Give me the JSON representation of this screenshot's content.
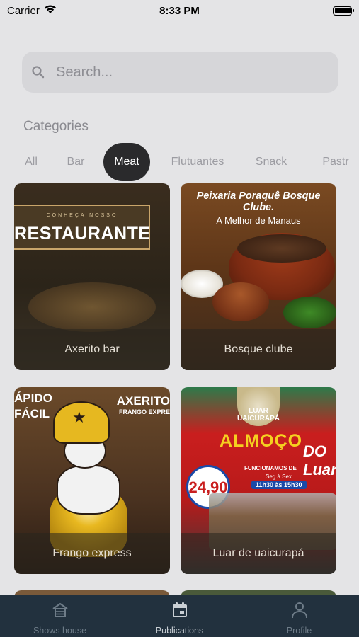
{
  "status_bar": {
    "carrier": "Carrier",
    "time": "8:33 PM",
    "battery_level": 1.0
  },
  "search": {
    "placeholder": "Search...",
    "value": ""
  },
  "categories": {
    "title": "Categories",
    "items": [
      "All",
      "Bar",
      "Meat",
      "Flutuantes",
      "Snack",
      "Pastr"
    ],
    "selected": "Meat"
  },
  "cards": [
    {
      "name": "Axerito bar",
      "art": {
        "line1": "CONHEÇA NOSSO",
        "line2": "RESTAURANTE"
      }
    },
    {
      "name": "Bosque clube",
      "art": {
        "line1": "Peixaria Poraquê Bosque Clube.",
        "line2": "A Melhor de Manaus"
      }
    },
    {
      "name": "Frango express",
      "art": {
        "left": "ÁPIDO\nFÁCIL",
        "right": "AXERITO",
        "right2": "FRANGO EXPRE"
      }
    },
    {
      "name": "Luar de uaicurapá",
      "art": {
        "logo": "LUAR\nUAICURAPÁ",
        "title": "ALMOÇO",
        "title2": "DO Luar!",
        "func": "FUNCIONAMOS DE",
        "days": "Seg à Sex",
        "hours": "11h30 às 15h30",
        "price": "24,90"
      }
    }
  ],
  "tabbar": {
    "items": [
      {
        "label": "Shows house",
        "icon": "house-icon"
      },
      {
        "label": "Publications",
        "icon": "calendar-icon"
      },
      {
        "label": "Profile",
        "icon": "person-icon"
      }
    ],
    "active": "Publications",
    "inactive_color": "#6e7c88",
    "active_color": "#c9cfd4",
    "background": "#22313e"
  }
}
